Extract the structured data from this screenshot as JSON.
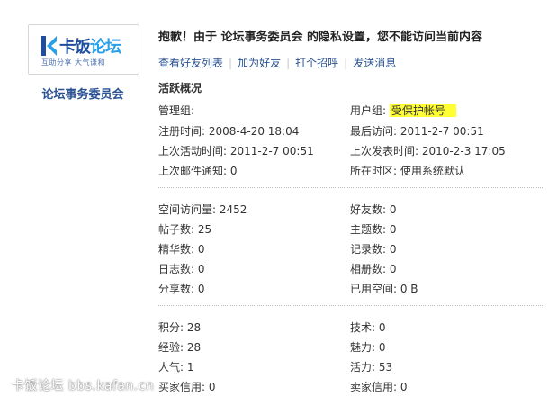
{
  "profile": {
    "logo": {
      "text_main": "卡饭",
      "text_accent": "论坛",
      "slogan": "互助分享  大气谦和"
    },
    "username": "论坛事务委员会"
  },
  "notice": "抱歉！由于 论坛事务委员会 的隐私设置，您不能访问当前内容",
  "actions": [
    {
      "label": "查看好友列表"
    },
    {
      "label": "加为好友"
    },
    {
      "label": "打个招呼"
    },
    {
      "label": "发送消息"
    }
  ],
  "activity": {
    "title": "活跃概况",
    "admin_group": "管理组:",
    "user_group_label": "用户组:",
    "user_group_value": "受保护帐号",
    "register_time": "注册时间: 2008-4-20 18:04",
    "last_visit": "最后访问: 2011-2-7 00:51",
    "last_active": "上次活动时间: 2011-2-7 00:51",
    "last_post": "上次发表时间: 2010-2-3 17:05",
    "last_mail": "上次邮件通知: 0",
    "timezone": "所在时区: 使用系统默认"
  },
  "stats": {
    "space_visits": "空间访问量: 2452",
    "friends": "好友数: 0",
    "posts": "帖子数: 25",
    "threads": "主题数: 0",
    "digests": "精华数: 0",
    "records": "记录数: 0",
    "blogs": "日志数: 0",
    "albums": "相册数: 0",
    "shares": "分享数: 0",
    "space_used": "已用空间: 0 B"
  },
  "credits": {
    "points": "积分: 28",
    "tech": "技术: 0",
    "experience": "经验: 28",
    "charm": "魅力: 0",
    "popularity": "人气: 1",
    "vitality": "活力: 53",
    "buyer_credit": "买家信用: 0",
    "seller_credit": "卖家信用: 0"
  },
  "watermark": "卡饭论坛 bbs.kafan.cn"
}
